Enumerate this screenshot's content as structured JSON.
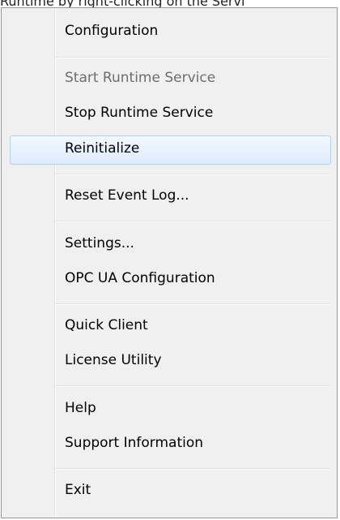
{
  "clipped_header_text": "Runtime by right-clicking on the Servi",
  "menu": {
    "items": [
      {
        "label": "Configuration",
        "disabled": false,
        "highlighted": false
      },
      {
        "label": "Start Runtime Service",
        "disabled": true,
        "highlighted": false
      },
      {
        "label": "Stop Runtime Service",
        "disabled": false,
        "highlighted": false
      },
      {
        "label": "Reinitialize",
        "disabled": false,
        "highlighted": true
      },
      {
        "label": "Reset Event Log...",
        "disabled": false,
        "highlighted": false
      },
      {
        "label": "Settings...",
        "disabled": false,
        "highlighted": false
      },
      {
        "label": "OPC UA Configuration",
        "disabled": false,
        "highlighted": false
      },
      {
        "label": "Quick Client",
        "disabled": false,
        "highlighted": false
      },
      {
        "label": "License Utility",
        "disabled": false,
        "highlighted": false
      },
      {
        "label": "Help",
        "disabled": false,
        "highlighted": false
      },
      {
        "label": "Support Information",
        "disabled": false,
        "highlighted": false
      },
      {
        "label": "Exit",
        "disabled": false,
        "highlighted": false
      }
    ]
  },
  "colors": {
    "menu_background": "#f0f0f0",
    "menu_border": "#979797",
    "disabled_text": "#6d6d6d",
    "highlight_border": "#aecff7",
    "highlight_fill": "#ddecfc"
  }
}
